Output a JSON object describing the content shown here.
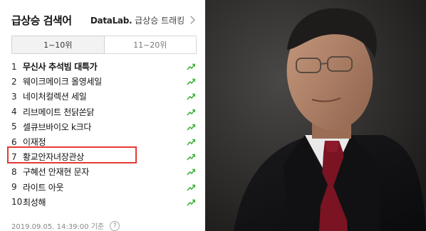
{
  "panel": {
    "title": "급상승 검색어",
    "brand_name": "DataLab.",
    "brand_link": "급상승 트래킹"
  },
  "tabs": [
    {
      "label": "1~10위",
      "active": true
    },
    {
      "label": "11~20위",
      "active": false
    }
  ],
  "items": [
    {
      "rank": "1",
      "keyword": "무신사 추석빔 대특가"
    },
    {
      "rank": "2",
      "keyword": "웨이크메이크 올영세일"
    },
    {
      "rank": "3",
      "keyword": "네이처컬렉션 세일"
    },
    {
      "rank": "4",
      "keyword": "리브메이트 천닭쏜닭"
    },
    {
      "rank": "5",
      "keyword": "셀큐브바이오 k크다"
    },
    {
      "rank": "6",
      "keyword": "이재정"
    },
    {
      "rank": "7",
      "keyword": "황교안자녀장관상"
    },
    {
      "rank": "8",
      "keyword": "구혜선 안재현 문자"
    },
    {
      "rank": "9",
      "keyword": "라이트 아웃"
    },
    {
      "rank": "10",
      "keyword": "최성해"
    }
  ],
  "footer": {
    "timestamp": "2019.09.05. 14:39:00 기준",
    "help_symbol": "?"
  },
  "colors": {
    "trend_green": "#3fb13a",
    "highlight_red": "#e53935"
  },
  "icons": {
    "trend": "trend-up-icon",
    "help": "help-icon"
  }
}
